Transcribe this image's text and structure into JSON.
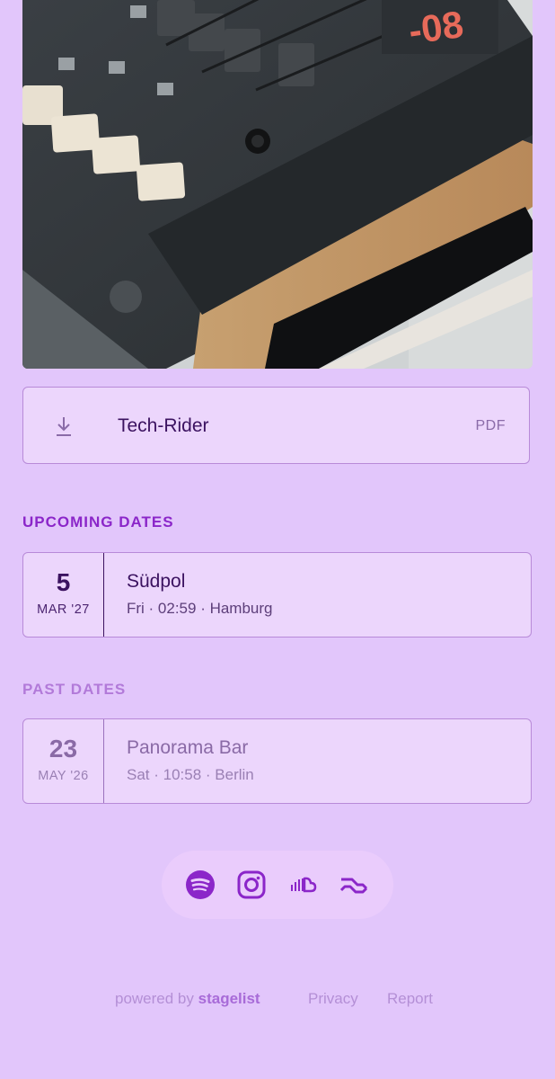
{
  "photo": {
    "alt": "synth-photo"
  },
  "tech_rider": {
    "label": "Tech-Rider",
    "file_type": "PDF",
    "icon": "download-icon"
  },
  "upcoming": {
    "heading": "UPCOMING DATES",
    "events": [
      {
        "day": "5",
        "month": "MAR '27",
        "venue": "Südpol",
        "meta": "Fri · 02:59 · Hamburg"
      }
    ]
  },
  "past": {
    "heading": "PAST DATES",
    "events": [
      {
        "day": "23",
        "month": "MAY '26",
        "venue": "Panorama Bar",
        "meta": "Sat · 10:58 · Berlin"
      }
    ]
  },
  "socials": [
    {
      "name": "spotify",
      "icon": "spotify-icon"
    },
    {
      "name": "instagram",
      "icon": "instagram-icon"
    },
    {
      "name": "soundcloud",
      "icon": "soundcloud-icon"
    },
    {
      "name": "resident-advisor",
      "icon": "resident-advisor-icon"
    }
  ],
  "footer": {
    "powered_prefix": "powered by",
    "brand": "stagelist",
    "privacy": "Privacy",
    "report": "Report"
  },
  "colors": {
    "background": "#e2c6fb",
    "accent": "#8b26c9",
    "card": "#ecd6fc",
    "text_dark": "#3b1260"
  }
}
